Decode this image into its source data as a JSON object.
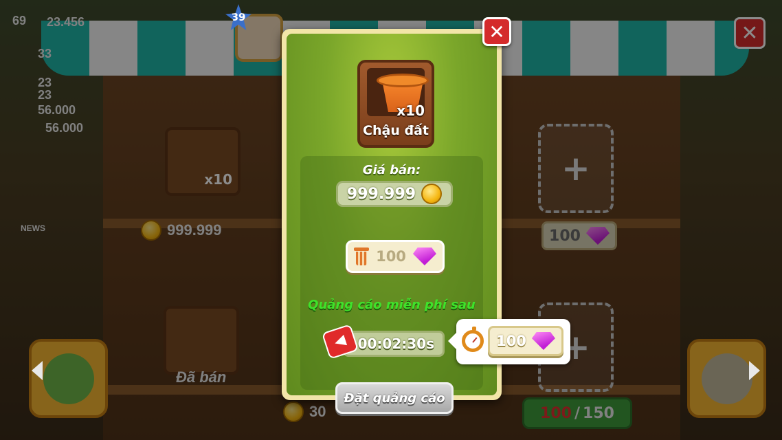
{
  "hud": {
    "level": "39",
    "stat_1": "69",
    "stat_1_value": "23.456",
    "stat_2": "33",
    "stat_3": "23",
    "stat_4": "23",
    "stat_5": "56.000",
    "stat_6": "56.000"
  },
  "background": {
    "left_slot": {
      "quantity": "x10",
      "price": "999.999"
    },
    "sold_label": "Đã bán",
    "right_slot_price": "100",
    "bottom_coin_value": "30",
    "storage": {
      "current": "100",
      "separator": "/",
      "max": "150"
    },
    "news_label": "NEWS"
  },
  "modal": {
    "item_name": "Chậu đất",
    "item_quantity": "x10",
    "price_label": "Giá bán:",
    "price_value": "999.999",
    "remove_cost": "100",
    "free_ad_label": "Quảng cáo miễn phí sau",
    "timer": "00:02:30s",
    "place_ad_label": "Đặt quảng cáo",
    "close_symbol": "✕"
  },
  "skip_popup": {
    "cost": "100"
  },
  "colors": {
    "accent_green": "#7aa62a",
    "free_ad_text": "#3fe22a",
    "close_red": "#d42b2b",
    "gem_pink": "#c21fd6"
  },
  "icons": [
    "pot-icon",
    "coin-icon",
    "gem-icon",
    "trash-icon",
    "megaphone-icon",
    "stopwatch-icon",
    "close-icon"
  ]
}
